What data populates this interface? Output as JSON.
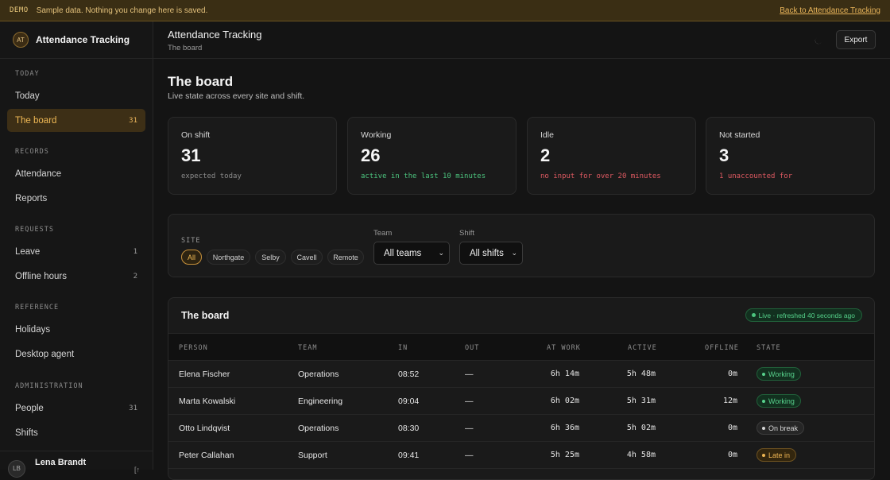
{
  "banner": {
    "tag": "DEMO",
    "message": "Sample data. Nothing you change here is saved.",
    "back_link": "Back to Attendance Tracking"
  },
  "sidebar": {
    "brand_initials": "AT",
    "brand_name": "Attendance Tracking",
    "sections": {
      "today": "TODAY",
      "records": "RECORDS",
      "requests": "REQUESTS",
      "reference": "REFERENCE",
      "administration": "ADMINISTRATION"
    },
    "items": {
      "today": {
        "label": "Today"
      },
      "board": {
        "label": "The board",
        "count": "31"
      },
      "attendance": {
        "label": "Attendance"
      },
      "reports": {
        "label": "Reports"
      },
      "leave": {
        "label": "Leave",
        "count": "1"
      },
      "offline": {
        "label": "Offline hours",
        "count": "2"
      },
      "holidays": {
        "label": "Holidays"
      },
      "desktop_agent": {
        "label": "Desktop agent"
      },
      "people": {
        "label": "People",
        "count": "31"
      },
      "shifts": {
        "label": "Shifts"
      }
    },
    "user": {
      "initials": "LB",
      "name": "Lena Brandt",
      "action": "[↑"
    }
  },
  "topbar": {
    "title": "Attendance Tracking",
    "subtitle": "The board",
    "export_label": "Export"
  },
  "page": {
    "title": "The board",
    "subtitle": "Live state across every site and shift."
  },
  "stats": [
    {
      "label": "On shift",
      "value": "31",
      "note": "expected today"
    },
    {
      "label": "Working",
      "value": "26",
      "note": "active in the last 10 minutes"
    },
    {
      "label": "Idle",
      "value": "2",
      "note": "no input for over 20 minutes"
    },
    {
      "label": "Not started",
      "value": "3",
      "note": "1 unaccounted for"
    }
  ],
  "filters": {
    "site_label": "SITE",
    "sites": [
      "All",
      "Northgate",
      "Selby",
      "Cavell",
      "Remote"
    ],
    "team_label": "Team",
    "team_value": "All teams",
    "shift_label": "Shift",
    "shift_value": "All shifts"
  },
  "board": {
    "title": "The board",
    "live_status": "Live · refreshed 40 seconds ago",
    "columns": [
      "PERSON",
      "TEAM",
      "IN",
      "OUT",
      "AT WORK",
      "ACTIVE",
      "OFFLINE",
      "STATE"
    ],
    "rows": [
      {
        "person": "Elena Fischer",
        "team": "Operations",
        "in": "08:52",
        "out": "—",
        "at_work": "6h 14m",
        "active": "5h 48m",
        "offline": "0m",
        "state": "Working"
      },
      {
        "person": "Marta Kowalski",
        "team": "Engineering",
        "in": "09:04",
        "out": "—",
        "at_work": "6h 02m",
        "active": "5h 31m",
        "offline": "12m",
        "state": "Working"
      },
      {
        "person": "Otto Lindqvist",
        "team": "Operations",
        "in": "08:30",
        "out": "—",
        "at_work": "6h 36m",
        "active": "5h 02m",
        "offline": "0m",
        "state": "On break"
      },
      {
        "person": "Peter Callahan",
        "team": "Support",
        "in": "09:41",
        "out": "—",
        "at_work": "5h 25m",
        "active": "4h 58m",
        "offline": "0m",
        "state": "Late in"
      }
    ]
  },
  "colors": {
    "accent": "#f0b955",
    "working": "#57d18c",
    "idle": "#e05a62"
  }
}
